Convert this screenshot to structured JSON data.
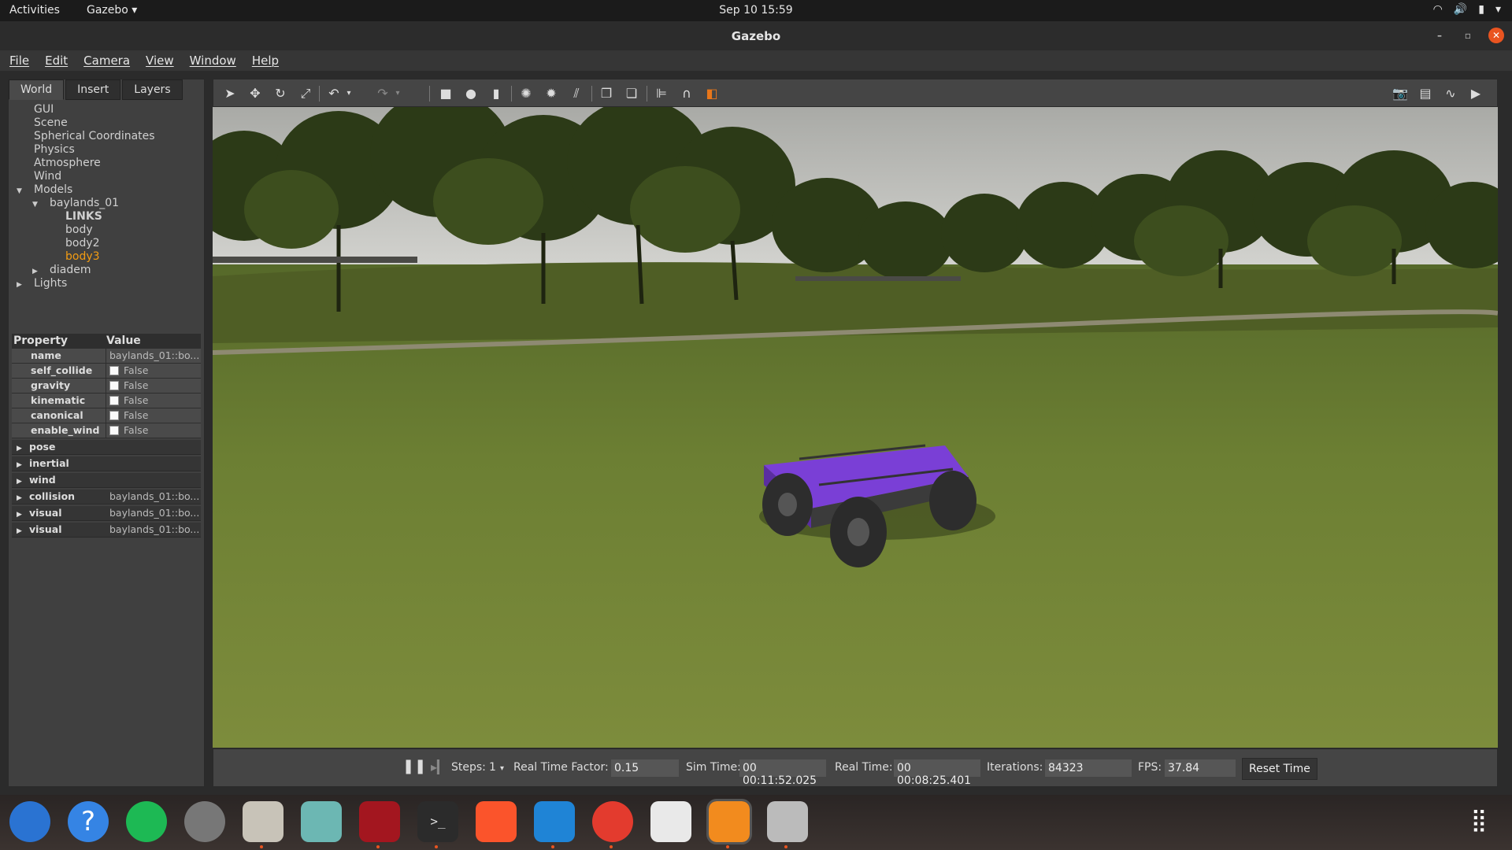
{
  "topbar": {
    "activities": "Activities",
    "app_menu": "Gazebo ▾",
    "clock": "Sep 10  15:59"
  },
  "window": {
    "title": "Gazebo"
  },
  "menubar": [
    "File",
    "Edit",
    "Camera",
    "View",
    "Window",
    "Help"
  ],
  "left_panel": {
    "tabs": [
      "World",
      "Insert",
      "Layers"
    ],
    "tree": [
      {
        "label": "GUI",
        "indent": 0,
        "arrow": ""
      },
      {
        "label": "Scene",
        "indent": 0,
        "arrow": ""
      },
      {
        "label": "Spherical Coordinates",
        "indent": 0,
        "arrow": ""
      },
      {
        "label": "Physics",
        "indent": 0,
        "arrow": ""
      },
      {
        "label": "Atmosphere",
        "indent": 0,
        "arrow": ""
      },
      {
        "label": "Wind",
        "indent": 0,
        "arrow": ""
      },
      {
        "label": "Models",
        "indent": 0,
        "arrow": "down"
      },
      {
        "label": "baylands_01",
        "indent": 1,
        "arrow": "down"
      },
      {
        "label": "LINKS",
        "indent": 2,
        "arrow": "",
        "style": "bold"
      },
      {
        "label": "body",
        "indent": 2,
        "arrow": ""
      },
      {
        "label": "body2",
        "indent": 2,
        "arrow": ""
      },
      {
        "label": "body3",
        "indent": 2,
        "arrow": "",
        "style": "selected"
      },
      {
        "label": "diadem",
        "indent": 1,
        "arrow": "right"
      },
      {
        "label": "Lights",
        "indent": 0,
        "arrow": "right"
      }
    ],
    "properties": {
      "header": {
        "property": "Property",
        "value": "Value"
      },
      "rows": [
        {
          "name": "name",
          "value": "baylands_01::bo...",
          "checkbox": false
        },
        {
          "name": "self_collide",
          "value": "False",
          "checkbox": true
        },
        {
          "name": "gravity",
          "value": "False",
          "checkbox": true
        },
        {
          "name": "kinematic",
          "value": "False",
          "checkbox": true
        },
        {
          "name": "canonical",
          "value": "False",
          "checkbox": true
        },
        {
          "name": "enable_wind",
          "value": "False",
          "checkbox": true
        }
      ],
      "groups": [
        {
          "name": "pose",
          "value": ""
        },
        {
          "name": "inertial",
          "value": ""
        },
        {
          "name": "wind",
          "value": ""
        },
        {
          "name": "collision",
          "value": "baylands_01::bo..."
        },
        {
          "name": "visual",
          "value": "baylands_01::bo..."
        },
        {
          "name": "visual",
          "value": "baylands_01::bo..."
        }
      ]
    }
  },
  "bottombar": {
    "steps_label": "Steps:",
    "steps_value": "1",
    "rtf_label": "Real Time Factor:",
    "rtf_value": "0.15",
    "sim_time_label": "Sim Time:",
    "sim_time_value": "00 00:11:52.025",
    "real_time_label": "Real Time:",
    "real_time_value": "00 00:08:25.401",
    "iterations_label": "Iterations:",
    "iterations_value": "84323",
    "fps_label": "FPS:",
    "fps_value": "37.84",
    "reset_label": "Reset Time"
  },
  "colors": {
    "accent": "#e95420",
    "selected_tree_item": "#f39c12",
    "robot": "#7a3fd6"
  }
}
